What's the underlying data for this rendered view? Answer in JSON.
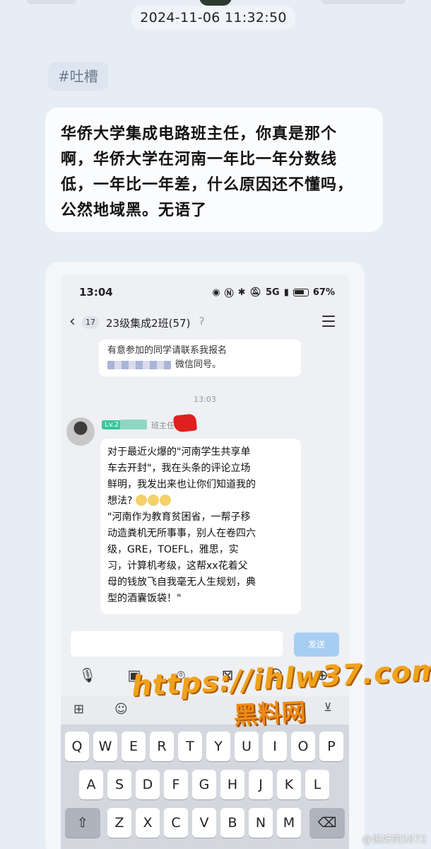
{
  "timestamp": "2024-11-06 11:32:50",
  "tag": "#吐槽",
  "post_text": "华侨大学集成电路班主任，你真是那个啊，华侨大学在河南一年比一年分数线低，一年比一年差，什么原因还不懂吗，公然地域黑。无语了",
  "phone": {
    "status_time": "13:04",
    "battery_label": "67%",
    "network_label": "5G",
    "header": {
      "unread_count": "17",
      "group_name": "23级集成2班(57)"
    },
    "previous_message": {
      "line1": "有意参加的同学请联系我报名",
      "line2": "微信同号。"
    },
    "chat_time": "13:03",
    "sender": {
      "level": "Lv.2",
      "role": "班主任"
    },
    "message_lines": [
      "对于最近火爆的\"河南学生共享单",
      "车去开封\"，我在头条的评论立场",
      "鲜明，我发出来也让你们知道我的",
      "想法?",
      "\"河南作为教育贫困省，一帮子移",
      "动造粪机无所事事，别人在卷四六",
      "级，GRE，TOEFL，雅思，实",
      "习，计算机考级，这帮xx花着父",
      "母的钱放飞自我毫无人生规划，典",
      "型的酒囊饭袋！\""
    ],
    "send_label": "发送",
    "keyboard": {
      "row1": [
        "Q",
        "W",
        "E",
        "R",
        "T",
        "Y",
        "U",
        "I",
        "O",
        "P"
      ],
      "row2": [
        "A",
        "S",
        "D",
        "F",
        "G",
        "H",
        "J",
        "K",
        "L"
      ],
      "row3": [
        "Z",
        "X",
        "C",
        "V",
        "B",
        "N",
        "M"
      ]
    }
  },
  "watermark": {
    "url": "https://ihlw37.com",
    "cn": "黑料网"
  },
  "weibo_mark": "@说好的5872"
}
